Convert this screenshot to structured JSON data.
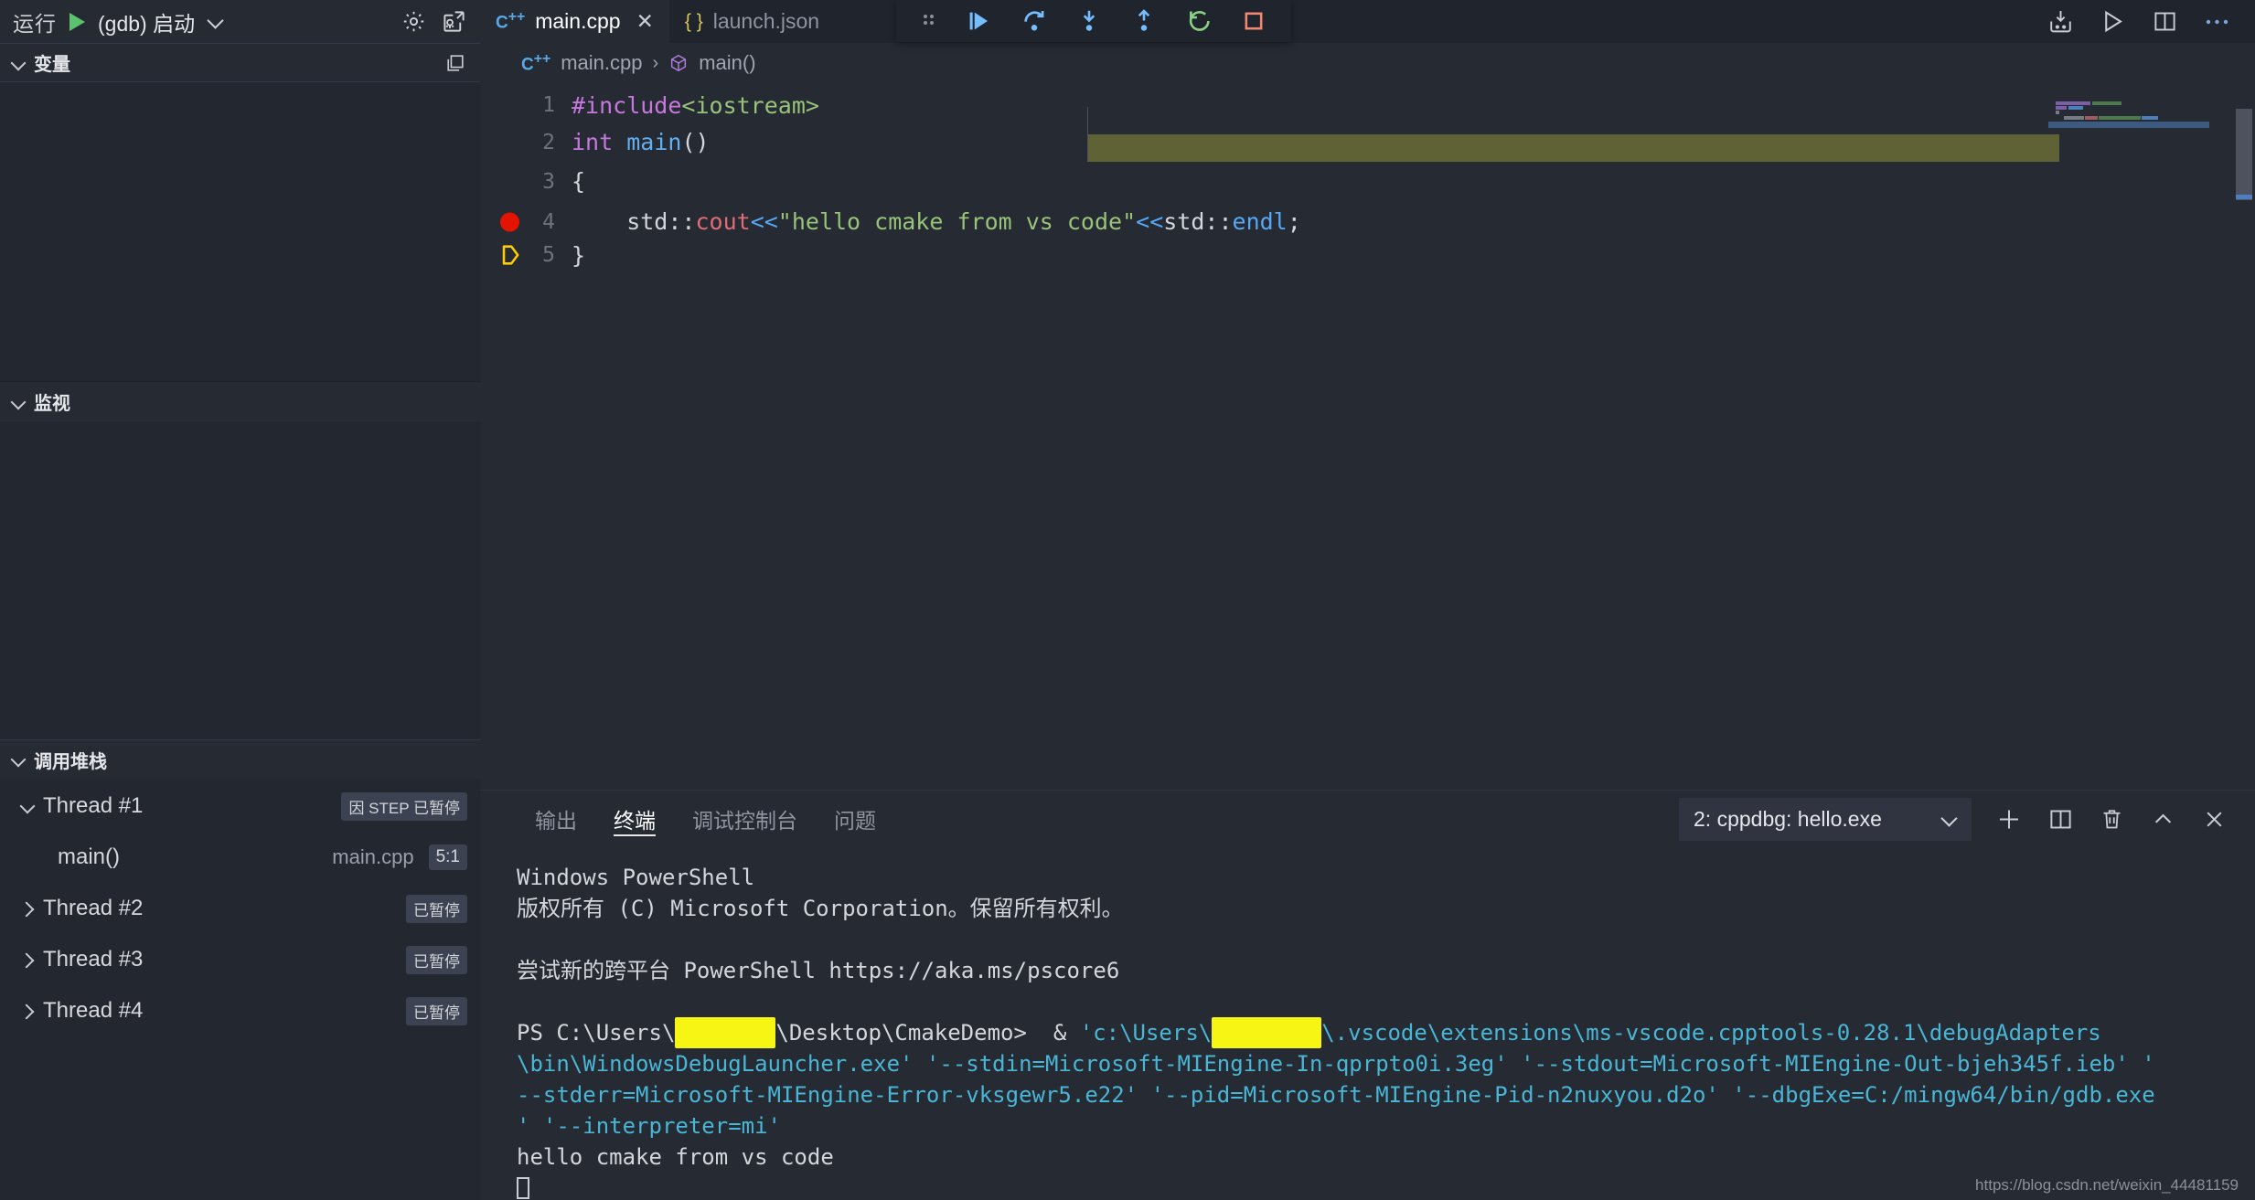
{
  "sidebar": {
    "header": {
      "run_label": "运行",
      "play_icon": "play-icon",
      "config_name": "(gdb) 启动",
      "dropdown_icon": "chevron-down-icon",
      "gear_icon": "gear-icon",
      "debug_console_icon": "open-debug-console-icon"
    },
    "variables": {
      "title": "变量",
      "collapse_icon": "chevron-down-icon",
      "pin_icon": "open-in-editor-icon"
    },
    "watch": {
      "title": "监视",
      "collapse_icon": "chevron-down-icon"
    },
    "callstack": {
      "title": "调用堆栈",
      "collapse_icon": "chevron-down-icon",
      "rows": [
        {
          "label": "Thread #1",
          "badge": "因 STEP 已暂停",
          "expanded": true,
          "type": "thread"
        },
        {
          "label": "main()",
          "file": "main.cpp",
          "line": "5:1",
          "type": "frame"
        },
        {
          "label": "Thread #2",
          "badge": "已暂停",
          "expanded": false,
          "type": "thread"
        },
        {
          "label": "Thread #3",
          "badge": "已暂停",
          "expanded": false,
          "type": "thread"
        },
        {
          "label": "Thread #4",
          "badge": "已暂停",
          "expanded": false,
          "type": "thread"
        }
      ]
    }
  },
  "editor": {
    "tabs": [
      {
        "label": "main.cpp",
        "icon": "cpp-file-icon",
        "active": true,
        "close_icon": "close-icon"
      },
      {
        "label": "launch.json",
        "icon": "json-file-icon",
        "active": false
      }
    ],
    "actions": [
      {
        "name": "install-extension-icon"
      },
      {
        "name": "run-code-icon"
      },
      {
        "name": "split-editor-icon"
      },
      {
        "name": "more-actions-icon"
      }
    ],
    "breadcrumb": {
      "file": "main.cpp",
      "symbol": "main()",
      "file_icon": "cpp-file-icon",
      "symbol_icon": "symbol-method-icon",
      "separator": "›"
    },
    "lines": [
      {
        "n": "1",
        "tokens": [
          {
            "t": "#include",
            "c": "#c678dd"
          },
          {
            "t": "<iostream>",
            "c": "#98c379"
          }
        ]
      },
      {
        "n": "2",
        "tokens": [
          {
            "t": "int ",
            "c": "#c678dd"
          },
          {
            "t": "main",
            "c": "#61afef"
          },
          {
            "t": "()",
            "c": "#d3d6db"
          }
        ]
      },
      {
        "n": "3",
        "tokens": [
          {
            "t": "{",
            "c": "#d3d6db"
          }
        ]
      },
      {
        "n": "4",
        "breakpoint": true,
        "tokens": [
          {
            "t": "    std::",
            "c": "#d3d6db"
          },
          {
            "t": "cout",
            "c": "#e06c75"
          },
          {
            "t": "<<",
            "c": "#56a8f5"
          },
          {
            "t": "\"hello cmake from vs code\"",
            "c": "#98c379"
          },
          {
            "t": "<<",
            "c": "#56a8f5"
          },
          {
            "t": "std::",
            "c": "#d3d6db"
          },
          {
            "t": "endl",
            "c": "#56a8f5"
          },
          {
            "t": ";",
            "c": "#d3d6db"
          }
        ]
      },
      {
        "n": "5",
        "current": true,
        "tokens": [
          {
            "t": "}",
            "c": "#d3d6db"
          }
        ]
      }
    ],
    "breakpoint_icon": "breakpoint-icon",
    "current_line_icon": "debug-stackframe-arrow-icon",
    "minimap_name": "minimap"
  },
  "panel": {
    "tabs": [
      {
        "label": "输出",
        "active": false
      },
      {
        "label": "终端",
        "active": true
      },
      {
        "label": "调试控制台",
        "active": false
      },
      {
        "label": "问题",
        "active": false
      }
    ],
    "terminal_select": {
      "value": "2: cppdbg: hello.exe",
      "dropdown_icon": "chevron-down-icon"
    },
    "actions": [
      {
        "name": "new-terminal-icon",
        "glyph": "+"
      },
      {
        "name": "split-terminal-icon"
      },
      {
        "name": "kill-terminal-icon"
      },
      {
        "name": "maximize-panel-icon"
      },
      {
        "name": "close-panel-icon"
      }
    ],
    "terminal_lines": [
      {
        "text": "Windows PowerShell"
      },
      {
        "text": "版权所有 (C) Microsoft Corporation。保留所有权利。"
      },
      {
        "text": ""
      },
      {
        "text": "尝试新的跨平台 PowerShell https://aka.ms/pscore6"
      },
      {
        "text": ""
      },
      {
        "prompt": true,
        "pre": "PS C:\\Users\\",
        "redact1_width": 110,
        "mid": "\\Desktop\\CmakeDemo>  & ",
        "cmd_pre": "'c:\\Users\\",
        "redact2_width": 120,
        "cmd_post": "\\.vscode\\extensions\\ms-vscode.cpptools-0.28.1\\debugAdapters"
      },
      {
        "cyan": "\\bin\\WindowsDebugLauncher.exe' '--stdin=Microsoft-MIEngine-In-qprpto0i.3eg' '--stdout=Microsoft-MIEngine-Out-bjeh345f.ieb' '"
      },
      {
        "cyan": "--stderr=Microsoft-MIEngine-Error-vksgewr5.e22' '--pid=Microsoft-MIEngine-Pid-n2nuxyou.d2o' '--dbgExe=C:/mingw64/bin/gdb.exe"
      },
      {
        "cyan": "' '--interpreter=mi'"
      },
      {
        "text": "hello cmake from vs code"
      },
      {
        "cursor": true
      }
    ]
  },
  "debug_toolbar": {
    "buttons": [
      {
        "name": "drag-handle-icon"
      },
      {
        "name": "continue-icon",
        "color": "#75beff"
      },
      {
        "name": "step-over-icon",
        "color": "#75beff"
      },
      {
        "name": "step-into-icon",
        "color": "#75beff"
      },
      {
        "name": "step-out-icon",
        "color": "#75beff"
      },
      {
        "name": "restart-icon",
        "color": "#89d185"
      },
      {
        "name": "stop-icon",
        "color": "#f48771"
      }
    ]
  },
  "watermark": {
    "text": "https://blog.csdn.net/weixin_44481159"
  },
  "colors": {
    "background": "#252a33",
    "panel_background": "#232730",
    "tab_inactive": "#20242d",
    "current_line_highlight": "#5f6235",
    "breakpoint_red": "#e51400",
    "current_arrow_yellow": "#ffcc00",
    "accent_blue": "#75beff",
    "restart_green": "#89d185",
    "stop_red": "#f48771",
    "redaction_yellow": "#f7f514"
  }
}
